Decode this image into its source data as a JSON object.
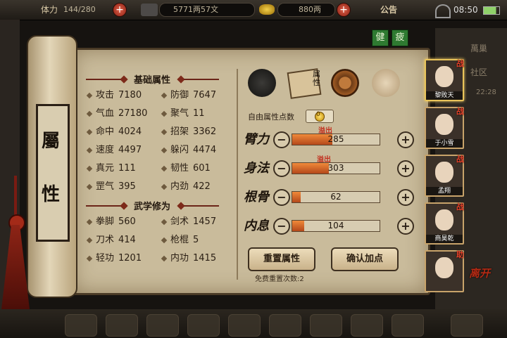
{
  "topbar": {
    "stamina_label": "体力",
    "stamina_value": "144/280",
    "money_value": "5771两57文",
    "gold_value": "880两",
    "announcement": "公告",
    "clock": "08:50",
    "plus_symbol": "+"
  },
  "side_buttons": {
    "health": "健",
    "tired": "疲"
  },
  "bg_labels": {
    "right_1": "萬巢",
    "right_2": "社区",
    "right_3": "22:28"
  },
  "scroll": {
    "title_top": "屬",
    "title_bottom": "性"
  },
  "basic": {
    "title": "基础属性",
    "stats": [
      {
        "label": "攻击",
        "value": "7180"
      },
      {
        "label": "防御",
        "value": "7647"
      },
      {
        "label": "气血",
        "value": "27180"
      },
      {
        "label": "聚气",
        "value": "11"
      },
      {
        "label": "命中",
        "value": "4024"
      },
      {
        "label": "招架",
        "value": "3362"
      },
      {
        "label": "速度",
        "value": "4497"
      },
      {
        "label": "躲闪",
        "value": "4474"
      },
      {
        "label": "真元",
        "value": "111"
      },
      {
        "label": "韧性",
        "value": "601"
      },
      {
        "label": "罡气",
        "value": "395"
      },
      {
        "label": "内劲",
        "value": "422"
      }
    ]
  },
  "martial": {
    "title": "武学修为",
    "stats": [
      {
        "label": "拳脚",
        "value": "560"
      },
      {
        "label": "剑术",
        "value": "1457"
      },
      {
        "label": "刀术",
        "value": "414"
      },
      {
        "label": "枪棍",
        "value": "5"
      },
      {
        "label": "轻功",
        "value": "1201"
      },
      {
        "label": "内功",
        "value": "1415"
      }
    ]
  },
  "tabs": [
    {
      "icon": "helmet-icon"
    },
    {
      "icon": "scroll-icon",
      "label": "属性"
    },
    {
      "icon": "taiji-icon"
    },
    {
      "icon": "meditate-icon"
    }
  ],
  "free_points": {
    "label": "自由属性点数",
    "value": "0"
  },
  "attributes": [
    {
      "name": "臂力",
      "value": "285",
      "fill": 0.46,
      "overflow": "溢出"
    },
    {
      "name": "身法",
      "value": "303",
      "fill": 0.42,
      "overflow": "溢出"
    },
    {
      "name": "根骨",
      "value": "62",
      "fill": 0.1,
      "overflow": ""
    },
    {
      "name": "内息",
      "value": "104",
      "fill": 0.14,
      "overflow": ""
    }
  ],
  "minus_symbol": "−",
  "plus_symbol": "+",
  "buttons": {
    "reset": "重置属性",
    "confirm": "确认加点"
  },
  "reset_count": "免费重置次数:2",
  "party": [
    {
      "name": "黎败天",
      "tag": "战",
      "selected": true
    },
    {
      "name": "于小雪",
      "tag": "战",
      "selected": false
    },
    {
      "name": "孟翔",
      "tag": "战",
      "selected": false
    },
    {
      "name": "商昊乾",
      "tag": "战",
      "selected": false
    },
    {
      "name": "",
      "tag": "助",
      "selected": false
    }
  ],
  "leave_label": "离开",
  "colors": {
    "accent": "#6b2418",
    "overflow": "#c2301e",
    "bar": "#e07a30",
    "parchment": "#c9bb9b"
  }
}
